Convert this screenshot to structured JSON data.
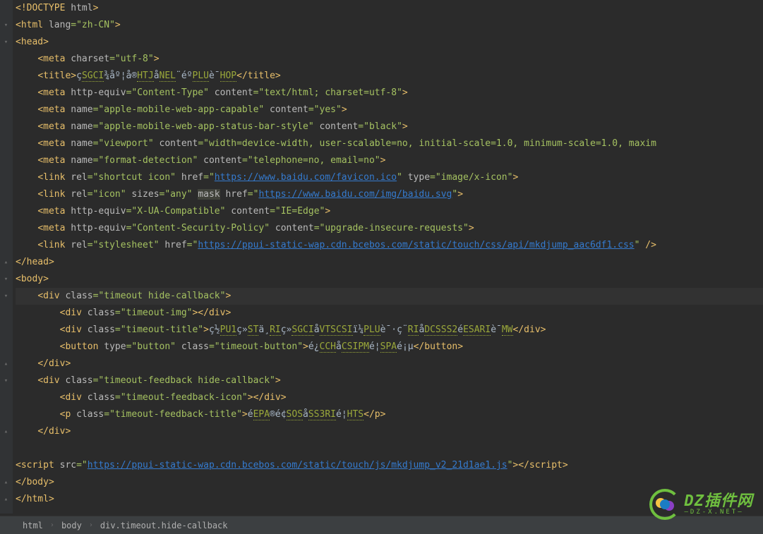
{
  "breadcrumb": {
    "a": "html",
    "b": "body",
    "c": "div.timeout.hide-callback"
  },
  "logo": {
    "top": "DZ插件网",
    "bot": "—DZ-X.NET—"
  },
  "tokens": {
    "l1": [
      [
        "c-tag",
        "<!DOCTYPE "
      ],
      [
        "c-attr",
        "html"
      ],
      [
        "c-tag",
        ">"
      ]
    ],
    "l2": [
      [
        "c-tag",
        "<html "
      ],
      [
        "c-attr",
        "lang"
      ],
      [
        "c-str",
        "=\"zh-CN\""
      ],
      [
        "c-tag",
        ">"
      ]
    ],
    "l3": [
      [
        "c-tag",
        "<head>"
      ]
    ],
    "l4": [
      [
        "c-tag",
        "<meta "
      ],
      [
        "c-attr",
        "charset"
      ],
      [
        "c-str",
        "=\"utf-8\""
      ],
      [
        "c-tag",
        ">"
      ]
    ],
    "l5": [
      [
        "c-tag",
        "<title>"
      ],
      [
        "c-text",
        "ç"
      ],
      [
        "boxed",
        "SGCI"
      ],
      [
        "c-text",
        "¾åº¦å®"
      ],
      [
        "boxed",
        "HTJ"
      ],
      [
        "c-text",
        "å"
      ],
      [
        "boxed",
        "NEL"
      ],
      [
        "c-text",
        "¨éº"
      ],
      [
        "boxed",
        "PLU"
      ],
      [
        "c-text",
        "è¯"
      ],
      [
        "boxed",
        "HOP"
      ],
      [
        "c-tag",
        "</title>"
      ]
    ],
    "l6": [
      [
        "c-tag",
        "<meta "
      ],
      [
        "c-attr",
        "http-equiv"
      ],
      [
        "c-str",
        "=\"Content-Type\" "
      ],
      [
        "c-attr",
        "content"
      ],
      [
        "c-str",
        "=\"text/html; charset=utf-8\""
      ],
      [
        "c-tag",
        ">"
      ]
    ],
    "l7": [
      [
        "c-tag",
        "<meta "
      ],
      [
        "c-attr",
        "name"
      ],
      [
        "c-str",
        "=\"apple-mobile-web-app-capable\" "
      ],
      [
        "c-attr",
        "content"
      ],
      [
        "c-str",
        "=\"yes\""
      ],
      [
        "c-tag",
        ">"
      ]
    ],
    "l8": [
      [
        "c-tag",
        "<meta "
      ],
      [
        "c-attr",
        "name"
      ],
      [
        "c-str",
        "=\"apple-mobile-web-app-status-bar-style\" "
      ],
      [
        "c-attr",
        "content"
      ],
      [
        "c-str",
        "=\"black\""
      ],
      [
        "c-tag",
        ">"
      ]
    ],
    "l9": [
      [
        "c-tag",
        "<meta "
      ],
      [
        "c-attr",
        "name"
      ],
      [
        "c-str",
        "=\"viewport\" "
      ],
      [
        "c-attr",
        "content"
      ],
      [
        "c-str",
        "=\"width=device-width, user-scalable=no, initial-scale=1.0, minimum-scale=1.0, maxim"
      ]
    ],
    "l10": [
      [
        "c-tag",
        "<meta "
      ],
      [
        "c-attr",
        "name"
      ],
      [
        "c-str",
        "=\"format-detection\" "
      ],
      [
        "c-attr",
        "content"
      ],
      [
        "c-str",
        "=\"telephone=no, email=no\""
      ],
      [
        "c-tag",
        ">"
      ]
    ],
    "l11": [
      [
        "c-tag",
        "<link "
      ],
      [
        "c-attr",
        "rel"
      ],
      [
        "c-str",
        "=\"shortcut icon\" "
      ],
      [
        "c-attr",
        "href"
      ],
      [
        "c-str",
        "=\""
      ],
      [
        "c-url",
        "https://www.baidu.com/favicon.ico"
      ],
      [
        "c-str",
        "\" "
      ],
      [
        "c-attr",
        "type"
      ],
      [
        "c-str",
        "=\"image/x-icon\""
      ],
      [
        "c-tag",
        ">"
      ]
    ],
    "l12": [
      [
        "c-tag",
        "<link "
      ],
      [
        "c-attr",
        "rel"
      ],
      [
        "c-str",
        "=\"icon\" "
      ],
      [
        "c-attr",
        "sizes"
      ],
      [
        "c-str",
        "=\"any\" "
      ],
      [
        "c-attr",
        "mask",
        "hl"
      ],
      [
        "c-punct",
        " "
      ],
      [
        "c-attr",
        "href"
      ],
      [
        "c-str",
        "=\""
      ],
      [
        "c-url",
        "https://www.baidu.com/img/baidu.svg"
      ],
      [
        "c-str",
        "\""
      ],
      [
        "c-tag",
        ">"
      ]
    ],
    "l13": [
      [
        "c-tag",
        "<meta "
      ],
      [
        "c-attr",
        "http-equiv"
      ],
      [
        "c-str",
        "=\"X-UA-Compatible\" "
      ],
      [
        "c-attr",
        "content"
      ],
      [
        "c-str",
        "=\"IE=Edge\""
      ],
      [
        "c-tag",
        ">"
      ]
    ],
    "l14": [
      [
        "c-tag",
        "<meta "
      ],
      [
        "c-attr",
        "http-equiv"
      ],
      [
        "c-str",
        "=\"Content-Security-Policy\" "
      ],
      [
        "c-attr",
        "content"
      ],
      [
        "c-str",
        "=\"upgrade-insecure-requests\""
      ],
      [
        "c-tag",
        ">"
      ]
    ],
    "l15": [
      [
        "c-tag",
        "<link "
      ],
      [
        "c-attr",
        "rel"
      ],
      [
        "c-str",
        "=\"stylesheet\" "
      ],
      [
        "c-attr",
        "href"
      ],
      [
        "c-str",
        "=\""
      ],
      [
        "c-url",
        "https://ppui-static-wap.cdn.bcebos.com/static/touch/css/api/mkdjump_aac6df1.css"
      ],
      [
        "c-str",
        "\" "
      ],
      [
        "c-tag",
        "/>"
      ]
    ],
    "l16": [
      [
        "c-tag",
        "</head>"
      ]
    ],
    "l17": [
      [
        "c-tag",
        "<body>"
      ]
    ],
    "l18": [
      [
        "c-tag",
        "<div "
      ],
      [
        "c-attr",
        "class"
      ],
      [
        "c-str",
        "=\"timeout hide-callback\""
      ],
      [
        "c-tag",
        ">"
      ]
    ],
    "l19": [
      [
        "c-tag",
        "<div "
      ],
      [
        "c-attr",
        "class"
      ],
      [
        "c-str",
        "=\"timeout-img\""
      ],
      [
        "c-tag",
        "></div>"
      ]
    ],
    "l20": [
      [
        "c-tag",
        "<div "
      ],
      [
        "c-attr",
        "class"
      ],
      [
        "c-str",
        "=\"timeout-title\""
      ],
      [
        "c-tag",
        ">"
      ],
      [
        "c-text",
        "ç½"
      ],
      [
        "boxed",
        "PU1"
      ],
      [
        "c-text",
        "ç»"
      ],
      [
        "boxed",
        "ST"
      ],
      [
        "c-text",
        "ä¸"
      ],
      [
        "boxed",
        "RI"
      ],
      [
        "c-text",
        "ç»"
      ],
      [
        "boxed",
        "SGCI"
      ],
      [
        "c-text",
        "å"
      ],
      [
        "boxed",
        "VTSCSI"
      ],
      [
        "c-text",
        "ï¼"
      ],
      [
        "boxed",
        "PLU"
      ],
      [
        "c-text",
        "è¯·ç¨"
      ],
      [
        "boxed",
        "RI"
      ],
      [
        "c-text",
        "å"
      ],
      [
        "boxed",
        "DCSSS2"
      ],
      [
        "c-text",
        "é"
      ],
      [
        "boxed",
        "ESARI"
      ],
      [
        "c-text",
        "è¯"
      ],
      [
        "boxed",
        "MW"
      ],
      [
        "c-tag",
        "</div>"
      ]
    ],
    "l21": [
      [
        "c-tag",
        "<button "
      ],
      [
        "c-attr",
        "type"
      ],
      [
        "c-str",
        "=\"button\" "
      ],
      [
        "c-attr",
        "class"
      ],
      [
        "c-str",
        "=\"timeout-button\""
      ],
      [
        "c-tag",
        ">"
      ],
      [
        "c-text",
        "é¿"
      ],
      [
        "boxed",
        "CCH"
      ],
      [
        "c-text",
        "å"
      ],
      [
        "boxed",
        "CSIPM"
      ],
      [
        "c-text",
        "é¦"
      ],
      [
        "boxed",
        "SPA"
      ],
      [
        "c-text",
        "é¡µ"
      ],
      [
        "c-tag",
        "</button>"
      ]
    ],
    "l22": [
      [
        "c-tag",
        "</div>"
      ]
    ],
    "l23": [
      [
        "c-tag",
        "<div "
      ],
      [
        "c-attr",
        "class"
      ],
      [
        "c-str",
        "=\"timeout-feedback hide-callback\""
      ],
      [
        "c-tag",
        ">"
      ]
    ],
    "l24": [
      [
        "c-tag",
        "<div "
      ],
      [
        "c-attr",
        "class"
      ],
      [
        "c-str",
        "=\"timeout-feedback-icon\""
      ],
      [
        "c-tag",
        "></div>"
      ]
    ],
    "l25": [
      [
        "c-tag",
        "<p "
      ],
      [
        "c-attr",
        "class"
      ],
      [
        "c-str",
        "=\"timeout-feedback-title\""
      ],
      [
        "c-tag",
        ">"
      ],
      [
        "c-text",
        "é"
      ],
      [
        "boxed",
        "EPA"
      ],
      [
        "c-text",
        "®é¢"
      ],
      [
        "boxed",
        "SOS"
      ],
      [
        "c-text",
        "å"
      ],
      [
        "boxed",
        "SS3RI"
      ],
      [
        "c-text",
        "é¦"
      ],
      [
        "boxed",
        "HTS"
      ],
      [
        "c-tag",
        "</p>"
      ]
    ],
    "l26": [
      [
        "c-tag",
        "</div>"
      ]
    ],
    "l27": [],
    "l28": [
      [
        "c-tag",
        "<script "
      ],
      [
        "c-attr",
        "src"
      ],
      [
        "c-str",
        "=\""
      ],
      [
        "c-url",
        "https://ppui-static-wap.cdn.bcebos.com/static/touch/js/mkdjump_v2_21d1ae1.js"
      ],
      [
        "c-str",
        "\""
      ],
      [
        "c-tag",
        "><"
      ],
      [
        "c-tag",
        "/script>"
      ]
    ],
    "l29": [
      [
        "c-tag",
        "</body>"
      ]
    ],
    "l30": [
      [
        "c-tag",
        "</html>"
      ]
    ]
  },
  "layout": [
    {
      "id": "l1",
      "indent": 0,
      "fold": ""
    },
    {
      "id": "l2",
      "indent": 0,
      "fold": "open"
    },
    {
      "id": "l3",
      "indent": 0,
      "fold": "open"
    },
    {
      "id": "l4",
      "indent": 4,
      "fold": ""
    },
    {
      "id": "l5",
      "indent": 4,
      "fold": ""
    },
    {
      "id": "l6",
      "indent": 4,
      "fold": ""
    },
    {
      "id": "l7",
      "indent": 4,
      "fold": ""
    },
    {
      "id": "l8",
      "indent": 4,
      "fold": ""
    },
    {
      "id": "l9",
      "indent": 4,
      "fold": ""
    },
    {
      "id": "l10",
      "indent": 4,
      "fold": ""
    },
    {
      "id": "l11",
      "indent": 4,
      "fold": ""
    },
    {
      "id": "l12",
      "indent": 4,
      "fold": ""
    },
    {
      "id": "l13",
      "indent": 4,
      "fold": ""
    },
    {
      "id": "l14",
      "indent": 4,
      "fold": ""
    },
    {
      "id": "l15",
      "indent": 4,
      "fold": ""
    },
    {
      "id": "l16",
      "indent": 0,
      "fold": "close"
    },
    {
      "id": "l17",
      "indent": 0,
      "fold": "open"
    },
    {
      "id": "l18",
      "indent": 4,
      "fold": "open",
      "hl": true
    },
    {
      "id": "l19",
      "indent": 8,
      "fold": ""
    },
    {
      "id": "l20",
      "indent": 8,
      "fold": ""
    },
    {
      "id": "l21",
      "indent": 8,
      "fold": ""
    },
    {
      "id": "l22",
      "indent": 4,
      "fold": "close"
    },
    {
      "id": "l23",
      "indent": 4,
      "fold": "open"
    },
    {
      "id": "l24",
      "indent": 8,
      "fold": ""
    },
    {
      "id": "l25",
      "indent": 8,
      "fold": ""
    },
    {
      "id": "l26",
      "indent": 4,
      "fold": "close"
    },
    {
      "id": "l27",
      "indent": 0,
      "fold": ""
    },
    {
      "id": "l28",
      "indent": 0,
      "fold": ""
    },
    {
      "id": "l29",
      "indent": 0,
      "fold": "close"
    },
    {
      "id": "l30",
      "indent": 0,
      "fold": "close"
    }
  ]
}
